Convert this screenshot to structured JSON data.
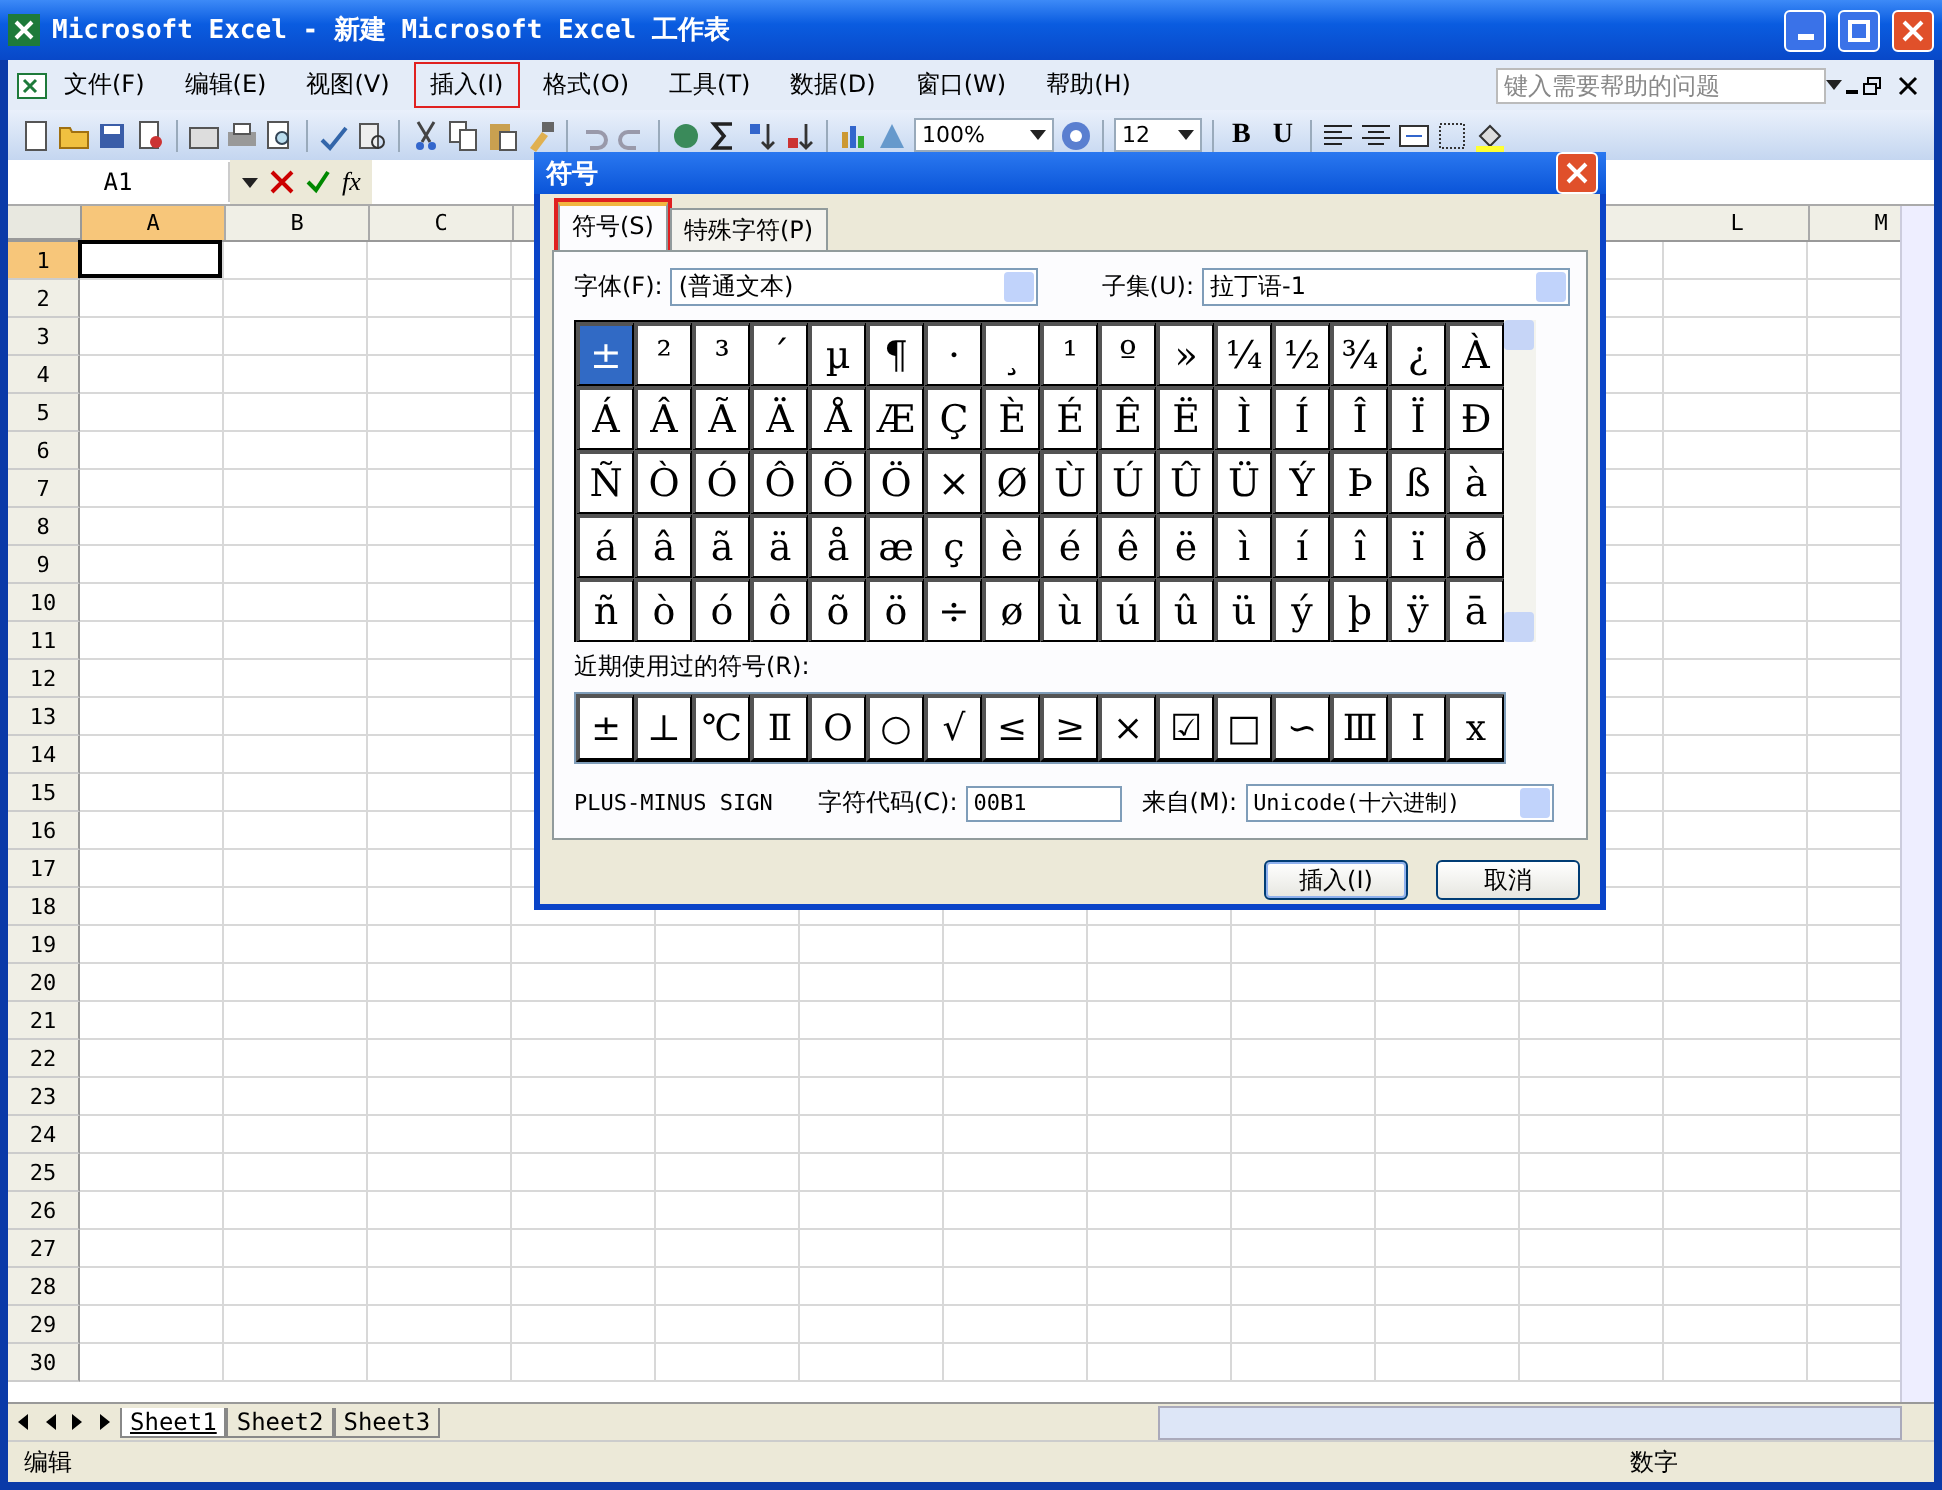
{
  "window": {
    "title": "Microsoft Excel - 新建 Microsoft Excel 工作表"
  },
  "menu": [
    {
      "label": "文件(F)",
      "highlighted": false
    },
    {
      "label": "编辑(E)",
      "highlighted": false
    },
    {
      "label": "视图(V)",
      "highlighted": false
    },
    {
      "label": "插入(I)",
      "highlighted": true
    },
    {
      "label": "格式(O)",
      "highlighted": false
    },
    {
      "label": "工具(T)",
      "highlighted": false
    },
    {
      "label": "数据(D)",
      "highlighted": false
    },
    {
      "label": "窗口(W)",
      "highlighted": false
    },
    {
      "label": "帮助(H)",
      "highlighted": false
    }
  ],
  "help_search": {
    "placeholder": "键入需要帮助的问题"
  },
  "toolbar": {
    "zoom": "100%",
    "font_size": "12",
    "bold": "B",
    "underline": "U"
  },
  "formula_bar": {
    "name_box": "A1",
    "function_label": "fx"
  },
  "sheet": {
    "columns_left": [
      {
        "label": "A",
        "selected": true
      },
      {
        "label": "B",
        "selected": false
      },
      {
        "label": "C",
        "selected": false
      }
    ],
    "columns_right": [
      {
        "label": "L",
        "selected": false
      },
      {
        "label": "M",
        "selected": false
      }
    ],
    "rows": [
      {
        "label": "1",
        "selected": true
      },
      {
        "label": "2",
        "selected": false
      },
      {
        "label": "3",
        "selected": false
      },
      {
        "label": "4",
        "selected": false
      },
      {
        "label": "5",
        "selected": false
      },
      {
        "label": "6",
        "selected": false
      },
      {
        "label": "7",
        "selected": false
      },
      {
        "label": "8",
        "selected": false
      },
      {
        "label": "9",
        "selected": false
      },
      {
        "label": "10",
        "selected": false
      },
      {
        "label": "11",
        "selected": false
      },
      {
        "label": "12",
        "selected": false
      },
      {
        "label": "13",
        "selected": false
      },
      {
        "label": "14",
        "selected": false
      },
      {
        "label": "15",
        "selected": false
      },
      {
        "label": "16",
        "selected": false
      },
      {
        "label": "17",
        "selected": false
      },
      {
        "label": "18",
        "selected": false
      },
      {
        "label": "19",
        "selected": false
      },
      {
        "label": "20",
        "selected": false
      },
      {
        "label": "21",
        "selected": false
      },
      {
        "label": "22",
        "selected": false
      },
      {
        "label": "23",
        "selected": false
      },
      {
        "label": "24",
        "selected": false
      },
      {
        "label": "25",
        "selected": false
      },
      {
        "label": "26",
        "selected": false
      },
      {
        "label": "27",
        "selected": false
      },
      {
        "label": "28",
        "selected": false
      },
      {
        "label": "29",
        "selected": false
      },
      {
        "label": "30",
        "selected": false
      }
    ]
  },
  "sheet_tabs": [
    {
      "label": "Sheet1",
      "selected": true
    },
    {
      "label": "Sheet2",
      "selected": false
    },
    {
      "label": "Sheet3",
      "selected": false
    }
  ],
  "status_bar": {
    "mode": "编辑",
    "indicator": "数字"
  },
  "dialog": {
    "title": "符号",
    "tabs": [
      {
        "label": "符号(S)",
        "selected": true,
        "highlighted": true
      },
      {
        "label": "特殊字符(P)",
        "selected": false,
        "highlighted": false
      }
    ],
    "font_label": "字体(F):",
    "font_value": "(普通文本)",
    "subset_label": "子集(U):",
    "subset_value": "拉丁语-1",
    "symbol_rows": [
      [
        {
          "char": "±",
          "selected": true
        },
        {
          "char": "²",
          "selected": false
        },
        {
          "char": "³",
          "selected": false
        },
        {
          "char": "´",
          "selected": false
        },
        {
          "char": "µ",
          "selected": false
        },
        {
          "char": "¶",
          "selected": false
        },
        {
          "char": "·",
          "selected": false
        },
        {
          "char": "¸",
          "selected": false
        },
        {
          "char": "¹",
          "selected": false
        },
        {
          "char": "º",
          "selected": false
        },
        {
          "char": "»",
          "selected": false
        },
        {
          "char": "¼",
          "selected": false
        },
        {
          "char": "½",
          "selected": false
        },
        {
          "char": "¾",
          "selected": false
        },
        {
          "char": "¿",
          "selected": false
        },
        {
          "char": "À",
          "selected": false
        }
      ],
      [
        {
          "char": "Á",
          "selected": false
        },
        {
          "char": "Â",
          "selected": false
        },
        {
          "char": "Ã",
          "selected": false
        },
        {
          "char": "Ä",
          "selected": false
        },
        {
          "char": "Å",
          "selected": false
        },
        {
          "char": "Æ",
          "selected": false
        },
        {
          "char": "Ç",
          "selected": false
        },
        {
          "char": "È",
          "selected": false
        },
        {
          "char": "É",
          "selected": false
        },
        {
          "char": "Ê",
          "selected": false
        },
        {
          "char": "Ë",
          "selected": false
        },
        {
          "char": "Ì",
          "selected": false
        },
        {
          "char": "Í",
          "selected": false
        },
        {
          "char": "Î",
          "selected": false
        },
        {
          "char": "Ï",
          "selected": false
        },
        {
          "char": "Ð",
          "selected": false
        }
      ],
      [
        {
          "char": "Ñ",
          "selected": false
        },
        {
          "char": "Ò",
          "selected": false
        },
        {
          "char": "Ó",
          "selected": false
        },
        {
          "char": "Ô",
          "selected": false
        },
        {
          "char": "Õ",
          "selected": false
        },
        {
          "char": "Ö",
          "selected": false
        },
        {
          "char": "×",
          "selected": false
        },
        {
          "char": "Ø",
          "selected": false
        },
        {
          "char": "Ù",
          "selected": false
        },
        {
          "char": "Ú",
          "selected": false
        },
        {
          "char": "Û",
          "selected": false
        },
        {
          "char": "Ü",
          "selected": false
        },
        {
          "char": "Ý",
          "selected": false
        },
        {
          "char": "Þ",
          "selected": false
        },
        {
          "char": "ß",
          "selected": false
        },
        {
          "char": "à",
          "selected": false
        }
      ],
      [
        {
          "char": "á",
          "selected": false
        },
        {
          "char": "â",
          "selected": false
        },
        {
          "char": "ã",
          "selected": false
        },
        {
          "char": "ä",
          "selected": false
        },
        {
          "char": "å",
          "selected": false
        },
        {
          "char": "æ",
          "selected": false
        },
        {
          "char": "ç",
          "selected": false
        },
        {
          "char": "è",
          "selected": false
        },
        {
          "char": "é",
          "selected": false
        },
        {
          "char": "ê",
          "selected": false
        },
        {
          "char": "ë",
          "selected": false
        },
        {
          "char": "ì",
          "selected": false
        },
        {
          "char": "í",
          "selected": false
        },
        {
          "char": "î",
          "selected": false
        },
        {
          "char": "ï",
          "selected": false
        },
        {
          "char": "ð",
          "selected": false
        }
      ],
      [
        {
          "char": "ñ",
          "selected": false
        },
        {
          "char": "ò",
          "selected": false
        },
        {
          "char": "ó",
          "selected": false
        },
        {
          "char": "ô",
          "selected": false
        },
        {
          "char": "õ",
          "selected": false
        },
        {
          "char": "ö",
          "selected": false
        },
        {
          "char": "÷",
          "selected": false
        },
        {
          "char": "ø",
          "selected": false
        },
        {
          "char": "ù",
          "selected": false
        },
        {
          "char": "ú",
          "selected": false
        },
        {
          "char": "û",
          "selected": false
        },
        {
          "char": "ü",
          "selected": false
        },
        {
          "char": "ý",
          "selected": false
        },
        {
          "char": "þ",
          "selected": false
        },
        {
          "char": "ÿ",
          "selected": false
        },
        {
          "char": "ā",
          "selected": false
        }
      ]
    ],
    "recent_label": "近期使用过的符号(R):",
    "recent_symbols": [
      "±",
      "⊥",
      "℃",
      "Ⅱ",
      "O",
      "○",
      "√",
      "≤",
      "≥",
      "×",
      "☑",
      "□",
      "∽",
      "Ⅲ",
      "Ⅰ",
      "x"
    ],
    "char_name": "PLUS-MINUS SIGN",
    "code_label": "字符代码(C):",
    "code_value": "00B1",
    "from_label": "来自(M):",
    "from_value": "Unicode(十六进制)",
    "buttons": [
      {
        "label": "插入(I)",
        "kind": "default"
      },
      {
        "label": "取消",
        "kind": "normal"
      }
    ]
  }
}
